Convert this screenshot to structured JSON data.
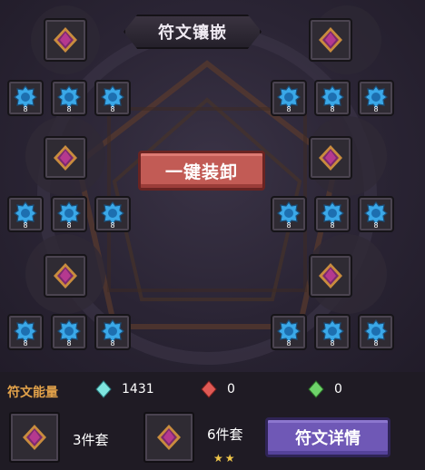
{
  "title": "符文镶嵌",
  "unequip_all_label": "一键装卸",
  "energy": {
    "label": "符文能量",
    "items": [
      {
        "icon": "cyan-gem-icon",
        "value": "1431"
      },
      {
        "icon": "red-gem-icon",
        "value": "0"
      },
      {
        "icon": "green-gem-icon",
        "value": "0"
      }
    ]
  },
  "sets": [
    {
      "label": "3件套",
      "stars": ""
    },
    {
      "label": "6件套",
      "stars": "★★"
    }
  ],
  "detail_button_label": "符文详情",
  "slot_level": "8",
  "colors": {
    "accent_orange": "#e2a24a",
    "unequip_red": "#c25b55",
    "detail_purple": "#6f58b6",
    "rune_blue": "#3aa8e8"
  }
}
